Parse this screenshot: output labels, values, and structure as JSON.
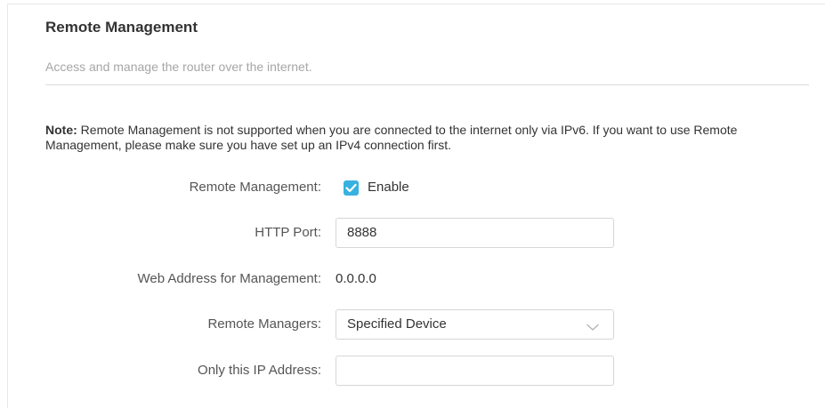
{
  "section": {
    "title": "Remote Management",
    "subtitle": "Access and manage the router over the internet."
  },
  "note": {
    "prefix": "Note:",
    "text": " Remote Management is not supported when you are connected to the internet only via IPv6. If you want to use Remote Management, please make sure you have set up an IPv4 connection first."
  },
  "form": {
    "remote_management": {
      "label": "Remote Management:",
      "checkbox_label": "Enable",
      "checked": true
    },
    "http_port": {
      "label": "HTTP Port:",
      "value": "8888"
    },
    "web_address": {
      "label": "Web Address for Management:",
      "value": "0.0.0.0"
    },
    "remote_managers": {
      "label": "Remote Managers:",
      "selected": "Specified Device"
    },
    "only_ip": {
      "label": "Only this IP Address:",
      "value": ""
    }
  },
  "colors": {
    "accent": "#38b1e0",
    "title_text": "#333333",
    "subtitle_text": "#a6a6a6"
  },
  "icons": {
    "checkbox": "check-icon",
    "dropdown": "chevron-down-icon"
  }
}
